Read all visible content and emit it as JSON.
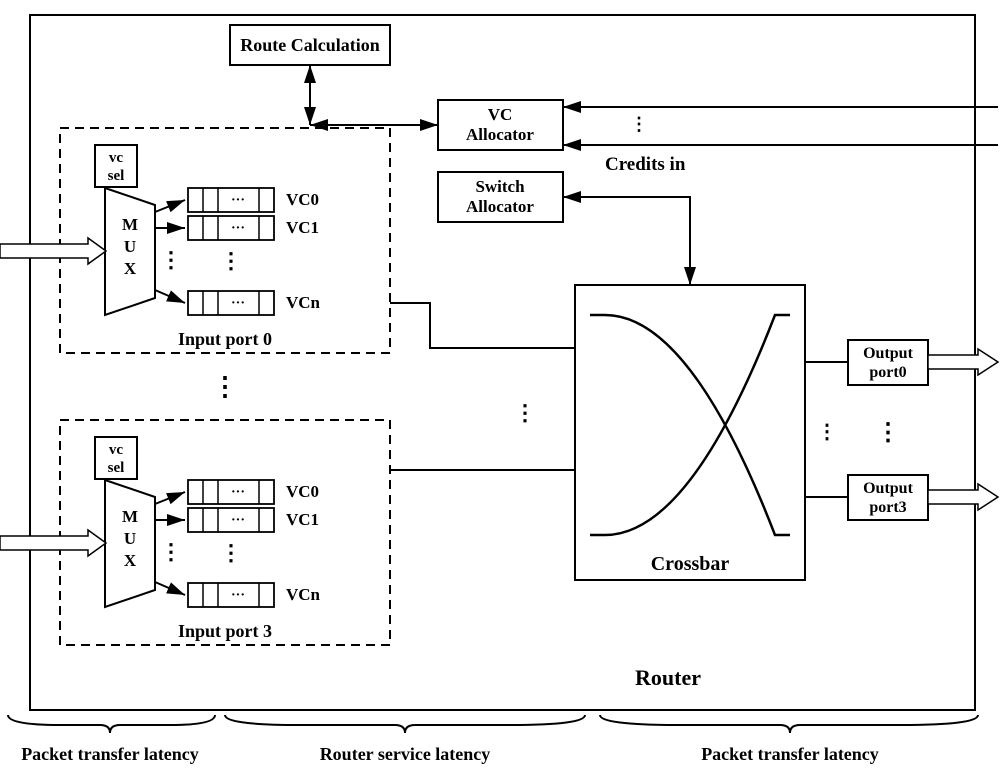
{
  "blocks": {
    "route_calc": "Route Calculation",
    "vc_allocator_l1": "VC",
    "vc_allocator_l2": "Allocator",
    "switch_allocator_l1": "Switch",
    "switch_allocator_l2": "Allocator",
    "crossbar": "Crossbar",
    "output0_l1": "Output",
    "output0_l2": "port0",
    "output3_l1": "Output",
    "output3_l2": "port3",
    "router": "Router",
    "credits_in": "Credits in"
  },
  "input_port": {
    "vc_sel_l1": "vc",
    "vc_sel_l2": "sel",
    "mux_M": "M",
    "mux_U": "U",
    "mux_X": "X",
    "buf_dots": "···",
    "vc0": "VC0",
    "vc1": "VC1",
    "vcn": "VCn",
    "label0": "Input port 0",
    "label3": "Input port 3"
  },
  "latency": {
    "packet_transfer": "Packet transfer latency",
    "router_service": "Router service latency"
  },
  "vdots": "⋮",
  "hdots": "···"
}
